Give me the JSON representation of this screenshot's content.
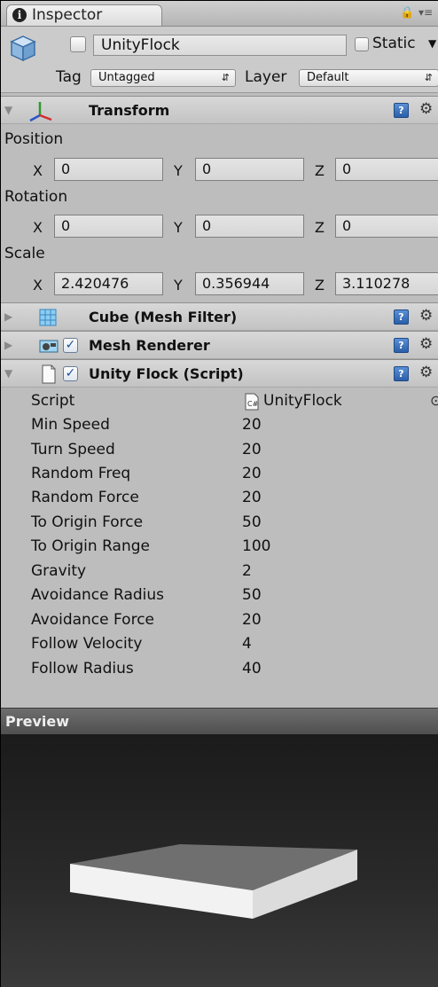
{
  "tab": {
    "icon": "info-icon",
    "label": "Inspector"
  },
  "header": {
    "object_name": "UnityFlock",
    "static_label": "Static",
    "tag_label": "Tag",
    "tag_value": "Untagged",
    "layer_label": "Layer",
    "layer_value": "Default"
  },
  "transform": {
    "title": "Transform",
    "position_label": "Position",
    "rotation_label": "Rotation",
    "scale_label": "Scale",
    "axis": {
      "x": "X",
      "y": "Y",
      "z": "Z"
    },
    "position": {
      "x": "0",
      "y": "0",
      "z": "0"
    },
    "rotation": {
      "x": "0",
      "y": "0",
      "z": "0"
    },
    "scale": {
      "x": "2.420476",
      "y": "0.356944",
      "z": "3.110278"
    }
  },
  "components": {
    "mesh_filter": {
      "title": "Cube (Mesh Filter)"
    },
    "mesh_renderer": {
      "title": "Mesh Renderer",
      "enabled": true
    },
    "script": {
      "title": "Unity Flock (Script)",
      "enabled": true
    }
  },
  "script_props": [
    {
      "name": "Script",
      "value": "UnityFlock"
    },
    {
      "name": "Min Speed",
      "value": "20"
    },
    {
      "name": "Turn Speed",
      "value": "20"
    },
    {
      "name": "Random Freq",
      "value": "20"
    },
    {
      "name": "Random Force",
      "value": "20"
    },
    {
      "name": "To Origin Force",
      "value": "50"
    },
    {
      "name": "To Origin Range",
      "value": "100"
    },
    {
      "name": "Gravity",
      "value": "2"
    },
    {
      "name": "Avoidance Radius",
      "value": "50"
    },
    {
      "name": "Avoidance Force",
      "value": "20"
    },
    {
      "name": "Follow Velocity",
      "value": "4"
    },
    {
      "name": "Follow Radius",
      "value": "40"
    }
  ],
  "preview": {
    "title": "Preview"
  },
  "colors": {
    "panel_bg": "#bdbdbd",
    "header_bg": "#cbcbcb",
    "preview_bar": "#5e5e5e",
    "preview_bg": "#2a2a2a",
    "checkbox_check": "#1d4f99",
    "help_icon": "#3a72c0"
  }
}
